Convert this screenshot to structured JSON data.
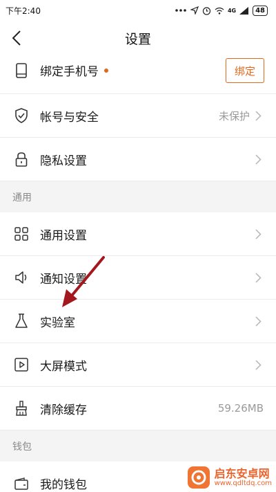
{
  "status_bar": {
    "time": "下午2:40",
    "signal_label": "4G",
    "battery": "48"
  },
  "header": {
    "title": "设置"
  },
  "rows_top": [
    {
      "label": "绑定手机号",
      "has_dot": true,
      "button": "绑定",
      "icon": "phone-icon"
    },
    {
      "label": "帐号与安全",
      "value": "未保护",
      "icon": "shield-icon"
    },
    {
      "label": "隐私设置",
      "value": "",
      "icon": "lock-icon"
    }
  ],
  "section_general": {
    "title": "通用"
  },
  "rows_general": [
    {
      "label": "通用设置",
      "icon": "grid-icon"
    },
    {
      "label": "通知设置",
      "icon": "speaker-icon"
    },
    {
      "label": "实验室",
      "icon": "flask-icon"
    },
    {
      "label": "大屏模式",
      "icon": "play-icon"
    },
    {
      "label": "清除缓存",
      "value": "59.26MB",
      "icon": "broom-icon"
    }
  ],
  "section_wallet": {
    "title": "钱包"
  },
  "rows_wallet": [
    {
      "label": "我的钱包",
      "icon": "wallet-icon"
    }
  ],
  "watermark": {
    "title": "启东安卓网",
    "url": "www.qdltdq.com"
  },
  "colors": {
    "accent": "#e0691c",
    "annotation_arrow": "#a3171e",
    "section_bg": "#f4f4f4"
  }
}
